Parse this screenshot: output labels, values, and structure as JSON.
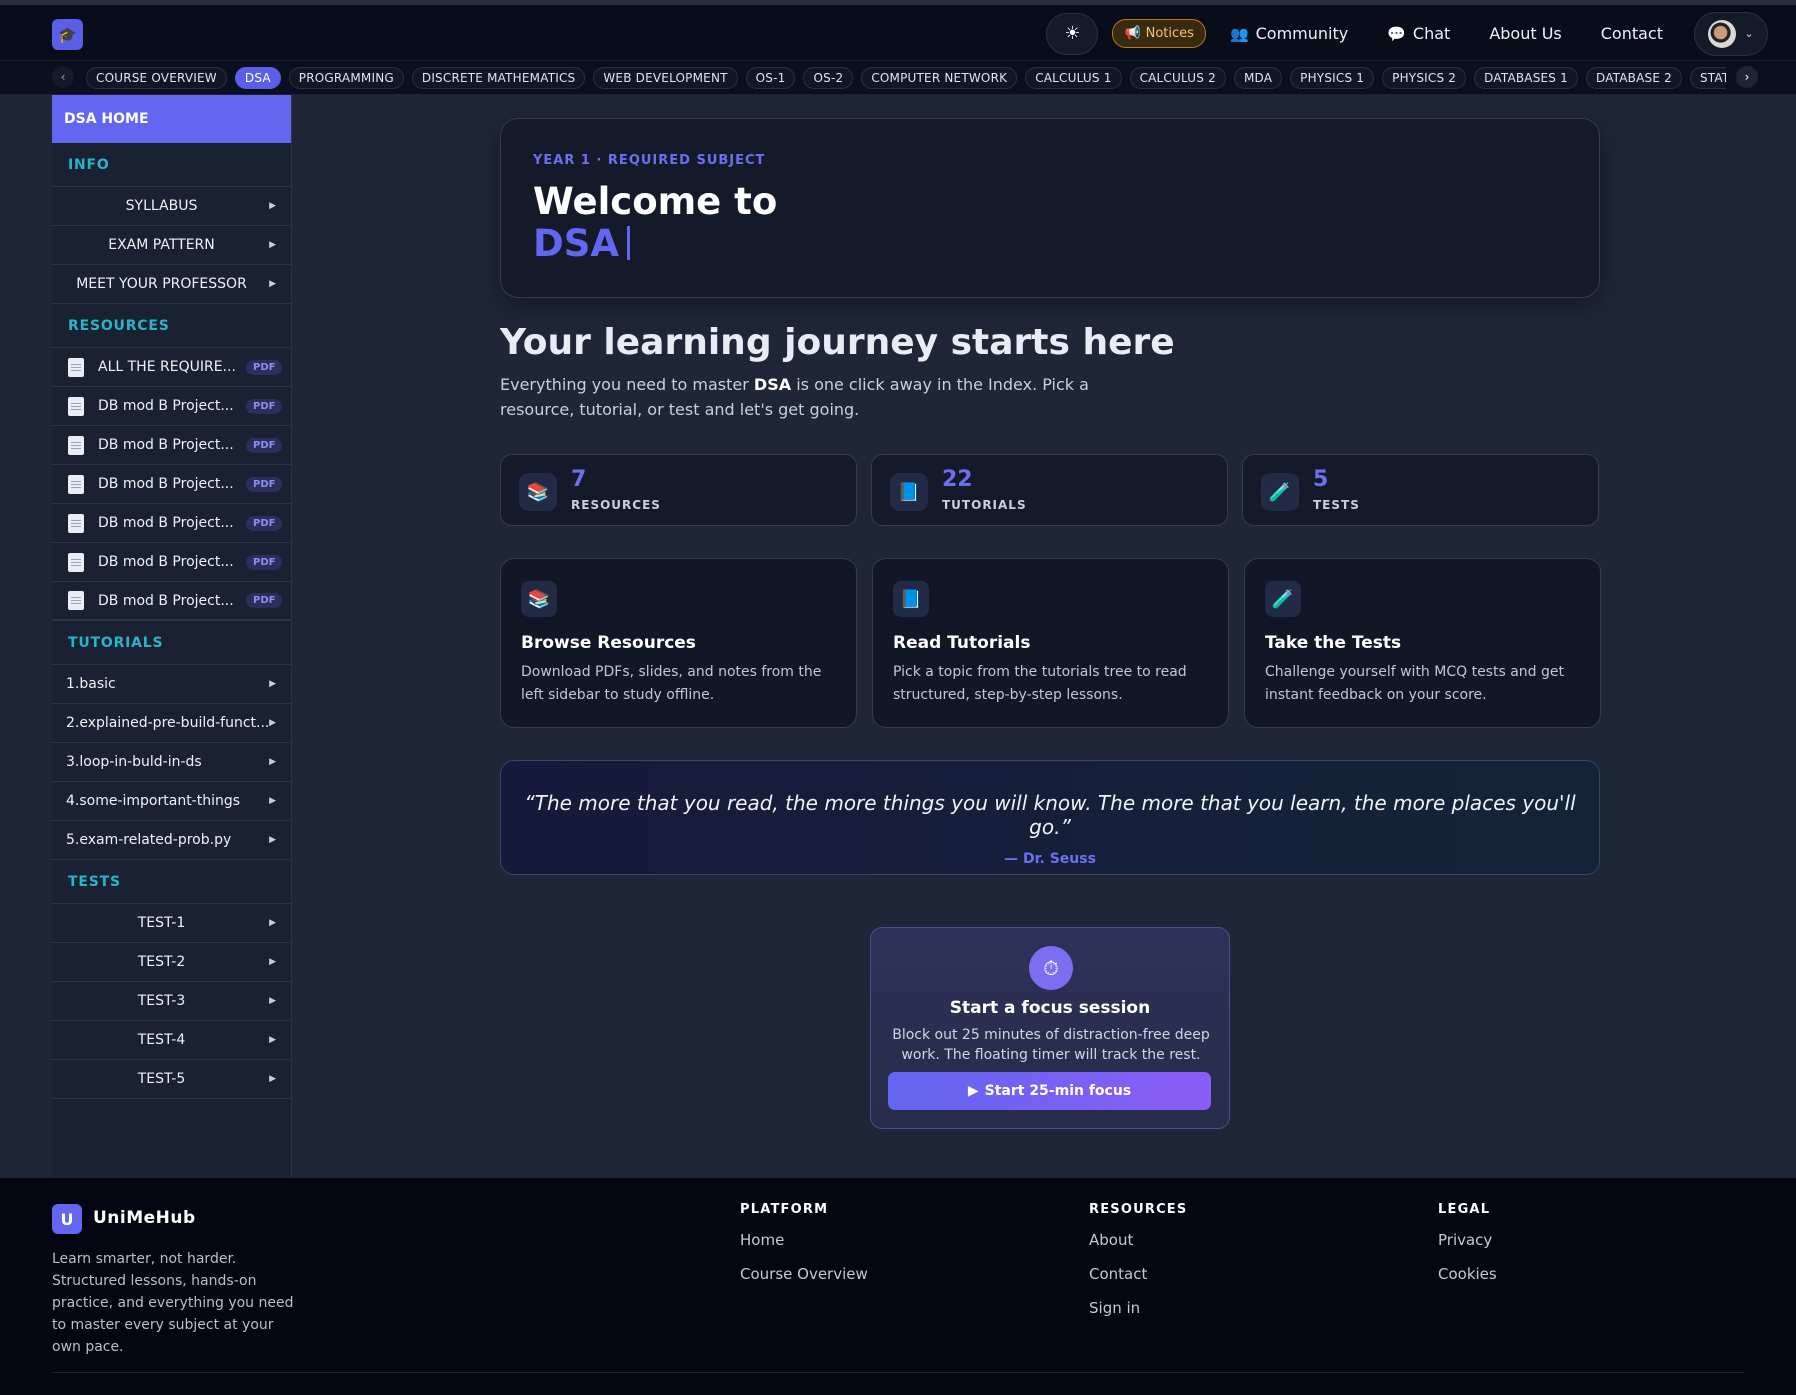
{
  "topnav": {
    "theme_icon": "sun-icon",
    "notices_label": "Notices",
    "links": [
      {
        "label": "Community",
        "icon": "people-icon"
      },
      {
        "label": "Chat",
        "icon": "chat-bubble-icon"
      },
      {
        "label": "About Us"
      },
      {
        "label": "Contact"
      }
    ]
  },
  "tabs": [
    "COURSE OVERVIEW",
    "DSA",
    "PROGRAMMING",
    "DISCRETE MATHEMATICS",
    "WEB DEVELOPMENT",
    "OS-1",
    "OS-2",
    "COMPUTER NETWORK",
    "CALCULUS 1",
    "CALCULUS 2",
    "MDA",
    "PHYSICS 1",
    "PHYSICS 2",
    "DATABASES 1",
    "DATABASE 2",
    "STATISTICAL I"
  ],
  "active_tab": "DSA",
  "sidebar": {
    "home": "DSA HOME",
    "info_head": "INFO",
    "info_items": [
      "SYLLABUS",
      "EXAM PATTERN",
      "MEET YOUR PROFESSOR"
    ],
    "resources_head": "RESOURCES",
    "resources": [
      {
        "name": "ALL THE REQUIRE...",
        "tag": "PDF"
      },
      {
        "name": "DB mod B Project...",
        "tag": "PDF"
      },
      {
        "name": "DB mod B Project...",
        "tag": "PDF"
      },
      {
        "name": "DB mod B Project...",
        "tag": "PDF"
      },
      {
        "name": "DB mod B Project...",
        "tag": "PDF"
      },
      {
        "name": "DB mod B Project...",
        "tag": "PDF"
      },
      {
        "name": "DB mod B Project...",
        "tag": "PDF"
      }
    ],
    "tutorials_head": "TUTORIALS",
    "tutorials": [
      "1.basic",
      "2.explained-pre-build-funct...",
      "3.loop-in-buld-in-ds",
      "4.some-important-things",
      "5.exam-related-prob.py"
    ],
    "tests_head": "TESTS",
    "tests": [
      "TEST-1",
      "TEST-2",
      "TEST-3",
      "TEST-4",
      "TEST-5"
    ]
  },
  "hero": {
    "eyebrow": "YEAR 1 · REQUIRED SUBJECT",
    "welcome": "Welcome to",
    "subject": "DSA"
  },
  "journey": {
    "title": "Your learning journey starts here",
    "sub_before": "Everything you need to master ",
    "sub_bold": "DSA",
    "sub_after": " is one click away in the Index. Pick a resource, tutorial, or test and let's get going."
  },
  "stats": [
    {
      "value": "7",
      "label": "RESOURCES",
      "icon": "books-icon"
    },
    {
      "value": "22",
      "label": "TUTORIALS",
      "icon": "book-icon"
    },
    {
      "value": "5",
      "label": "TESTS",
      "icon": "test-tube-icon"
    }
  ],
  "cards": [
    {
      "title": "Browse Resources",
      "desc": "Download PDFs, slides, and notes from the left sidebar to study offline.",
      "icon": "books-icon"
    },
    {
      "title": "Read Tutorials",
      "desc": "Pick a topic from the tutorials tree to read structured, step-by-step lessons.",
      "icon": "book-icon"
    },
    {
      "title": "Take the Tests",
      "desc": "Challenge yourself with MCQ tests and get instant feedback on your score.",
      "icon": "test-tube-icon"
    }
  ],
  "quote": {
    "text": "“The more that you read, the more things you will know. The more that you learn, the more places you'll go.”",
    "author": "— Dr. Seuss"
  },
  "focus": {
    "title": "Start a focus session",
    "desc": "Block out 25 minutes of distraction-free deep work. The floating timer will track the rest.",
    "button": "Start 25-min focus"
  },
  "footer": {
    "logo_letter": "U",
    "brand": "UniMeHub",
    "desc": "Learn smarter, not harder. Structured lessons, hands-on practice, and everything you need to master every subject at your own pace.",
    "platform_head": "PLATFORM",
    "platform_links": [
      "Home",
      "Course Overview"
    ],
    "resources_head": "RESOURCES",
    "resources_links": [
      "About",
      "Contact",
      "Sign in"
    ],
    "legal_head": "LEGAL",
    "legal_links": [
      "Privacy",
      "Cookies"
    ]
  },
  "colors": {
    "accent": "#6366f1",
    "section_head": "#2bb3c8",
    "background": "#1e2638"
  }
}
